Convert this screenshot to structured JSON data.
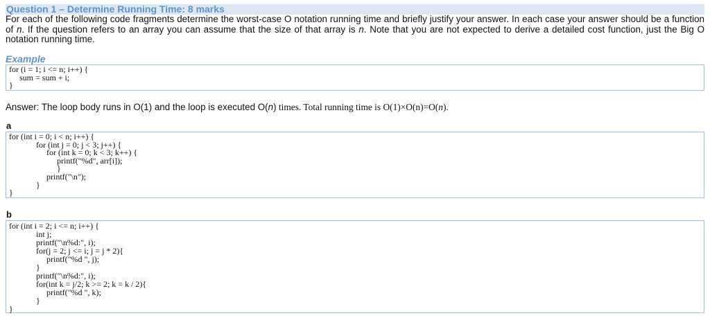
{
  "title": "Question 1 – Determine Running Time: 8 marks",
  "intro": {
    "p1": "For each of the following code fragments determine the worst-case O notation running time and briefly justify your answer. In each case your answer should be a function of ",
    "n1": "n",
    "p2": ". If the question refers to an array you can assume that the size of that array is ",
    "n2": "n",
    "p3": ". Note that you are not expected to derive a detailed cost function, just the Big O notation running time."
  },
  "example": {
    "label": "Example",
    "code": [
      "for (i = 1; i <= n; i++) {",
      "     sum = sum + i;",
      "}"
    ]
  },
  "answer": {
    "a": "Answer: The loop body runs in O(1) and the loop is executed O(",
    "b": "n",
    "c": ")",
    "d": " times. Total running time is O(1)×O(n)=O(",
    "e": "n",
    "f": ")."
  },
  "part_a": {
    "label": "a",
    "code": [
      "for (int i = 0; i < n; i++) {",
      "             for (int j = 0; j < 3; j++) {",
      "                  for (int k = 0; k < 3; k++) {",
      "                       printf(\"%d\", arr[i]);",
      "                       }",
      "                  printf(\"\\n\");",
      "             }",
      "}"
    ]
  },
  "part_b": {
    "label": "b",
    "code": [
      "for (int i = 2; i <= n; i++) {",
      "             int j;",
      "             printf(\"\\n%d:\", i);",
      "             for(j = 2; j <= i; j = j * 2){",
      "                  printf(\"%d \", j);",
      "             }",
      "             printf(\"\\n%d:\", i);",
      "             for(int k = j/2; k >= 2; k = k / 2){",
      "                  printf(\"%d \", k);",
      "             }",
      "}"
    ]
  }
}
